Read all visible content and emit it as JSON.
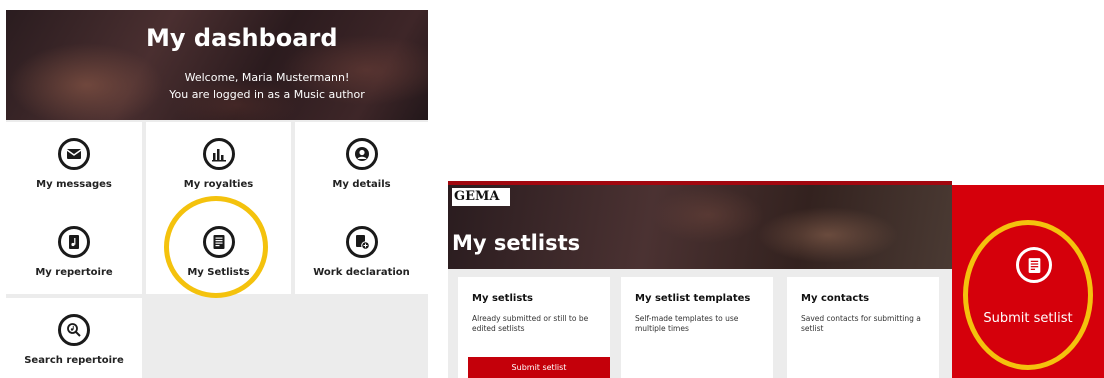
{
  "dashboard": {
    "title": "My dashboard",
    "welcome": "Welcome, Maria Mustermann!",
    "role": "You are logged in as a Music author",
    "tiles": [
      {
        "label": "My messages",
        "icon": "envelope-icon"
      },
      {
        "label": "My royalties",
        "icon": "bar-chart-icon"
      },
      {
        "label": "My details",
        "icon": "user-icon"
      },
      {
        "label": "My repertoire",
        "icon": "music-file-icon"
      },
      {
        "label": "My Setlists",
        "icon": "setlist-icon"
      },
      {
        "label": "Work declaration",
        "icon": "add-document-icon"
      },
      {
        "label": "Search repertoire",
        "icon": "search-note-icon"
      }
    ]
  },
  "setlists": {
    "logo": "GEMA",
    "title": "My setlists",
    "cards": [
      {
        "title": "My setlists",
        "description": "Already submitted or still to be edited setlists",
        "button": "Submit setlist"
      },
      {
        "title": "My setlist templates",
        "description": "Self-made templates to use multiple times"
      },
      {
        "title": "My contacts",
        "description": "Saved contacts for submitting a setlist"
      }
    ],
    "submit_panel": {
      "label": "Submit setlist",
      "icon": "setlist-icon"
    }
  },
  "colors": {
    "accent_red": "#d5000b",
    "highlight_ring": "#f4c20d"
  }
}
